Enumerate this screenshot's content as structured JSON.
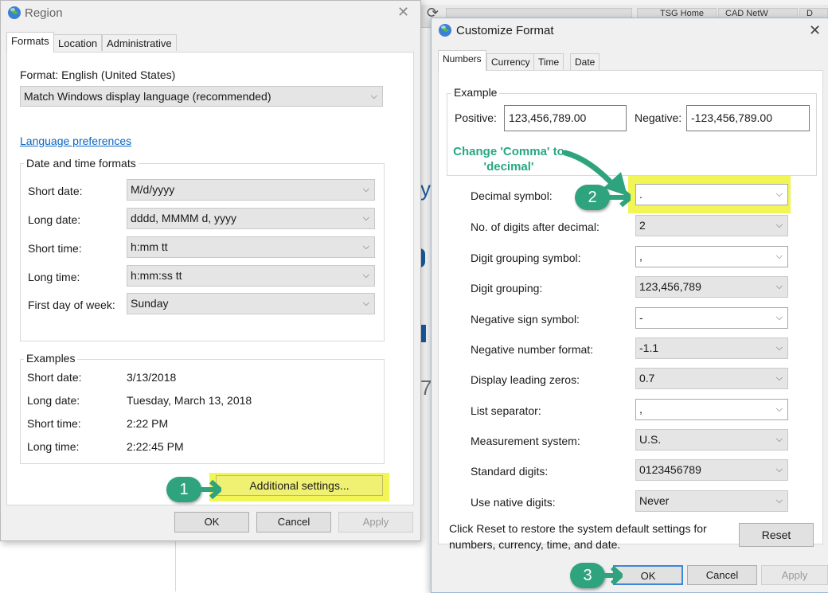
{
  "background": {
    "tabs": [
      "",
      "TSG Home",
      "CAD NetW",
      "D"
    ],
    "fragments": [
      "y",
      "",
      "",
      "7"
    ]
  },
  "region": {
    "title": "Region",
    "tabs": [
      "Formats",
      "Location",
      "Administrative"
    ],
    "format_label": "Format: English (United States)",
    "format_value": "Match Windows display language (recommended)",
    "language_link": "Language preferences",
    "datetime_legend": "Date and time formats",
    "rows": [
      {
        "label": "Short date:",
        "value": "M/d/yyyy"
      },
      {
        "label": "Long date:",
        "value": "dddd, MMMM d, yyyy"
      },
      {
        "label": "Short time:",
        "value": "h:mm tt"
      },
      {
        "label": "Long time:",
        "value": "h:mm:ss tt"
      },
      {
        "label": "First day of week:",
        "value": "Sunday"
      }
    ],
    "examples_legend": "Examples",
    "examples": [
      {
        "label": "Short date:",
        "value": "3/13/2018"
      },
      {
        "label": "Long date:",
        "value": "Tuesday, March 13, 2018"
      },
      {
        "label": "Short time:",
        "value": "2:22 PM"
      },
      {
        "label": "Long time:",
        "value": "2:22:45 PM"
      }
    ],
    "additional_settings": "Additional settings...",
    "ok": "OK",
    "cancel": "Cancel",
    "apply": "Apply"
  },
  "customize": {
    "title": "Customize Format",
    "tabs": [
      "Numbers",
      "Currency",
      "Time",
      "Date"
    ],
    "example_legend": "Example",
    "positive_label": "Positive:",
    "positive_value": "123,456,789.00",
    "negative_label": "Negative:",
    "negative_value": "-123,456,789.00",
    "settings": [
      {
        "label": "Decimal symbol:",
        "value": "."
      },
      {
        "label": "No. of digits after decimal:",
        "value": "2"
      },
      {
        "label": "Digit grouping symbol:",
        "value": ","
      },
      {
        "label": "Digit grouping:",
        "value": "123,456,789"
      },
      {
        "label": "Negative sign symbol:",
        "value": "-"
      },
      {
        "label": "Negative number format:",
        "value": "-1.1"
      },
      {
        "label": "Display leading zeros:",
        "value": "0.7"
      },
      {
        "label": "List separator:",
        "value": ","
      },
      {
        "label": "Measurement system:",
        "value": "U.S."
      },
      {
        "label": "Standard digits:",
        "value": "0123456789"
      },
      {
        "label": "Use native digits:",
        "value": "Never"
      }
    ],
    "reset_text": "Click Reset to restore the system default settings for numbers, currency, time, and date.",
    "reset": "Reset",
    "ok": "OK",
    "cancel": "Cancel",
    "apply": "Apply"
  },
  "annotations": {
    "step1": "1",
    "step2": "2",
    "step3": "3",
    "note": "Change 'Comma' to 'decimal'",
    "accent_color": "#2fa37d",
    "highlight_color": "#ecf21e"
  }
}
